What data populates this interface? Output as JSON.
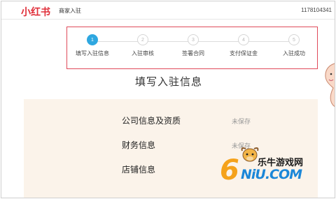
{
  "header": {
    "logo": "小红书",
    "breadcrumb": "商家入驻",
    "account_id": "1178104341"
  },
  "steps": [
    {
      "number": "1",
      "label": "填写入驻信息",
      "active": true
    },
    {
      "number": "2",
      "label": "入驻审核",
      "active": false
    },
    {
      "number": "3",
      "label": "签署合同",
      "active": false
    },
    {
      "number": "4",
      "label": "支付保证金",
      "active": false
    },
    {
      "number": "5",
      "label": "入驻成功",
      "active": false
    }
  ],
  "page_title": "填写入驻信息",
  "sections": [
    {
      "label": "公司信息及资质",
      "status": "未保存"
    },
    {
      "label": "财务信息",
      "status": "未保存"
    },
    {
      "label": "店铺信息",
      "status": ""
    }
  ],
  "watermark": {
    "text": "乐牛游戏网",
    "domain_mark": "6",
    "domain": "NiU.COM"
  },
  "colors": {
    "brand": "#e02f3a",
    "step_active": "#2ea7e0",
    "highlight_border": "#e04a5a",
    "panel_bg": "#fbf3ea"
  }
}
